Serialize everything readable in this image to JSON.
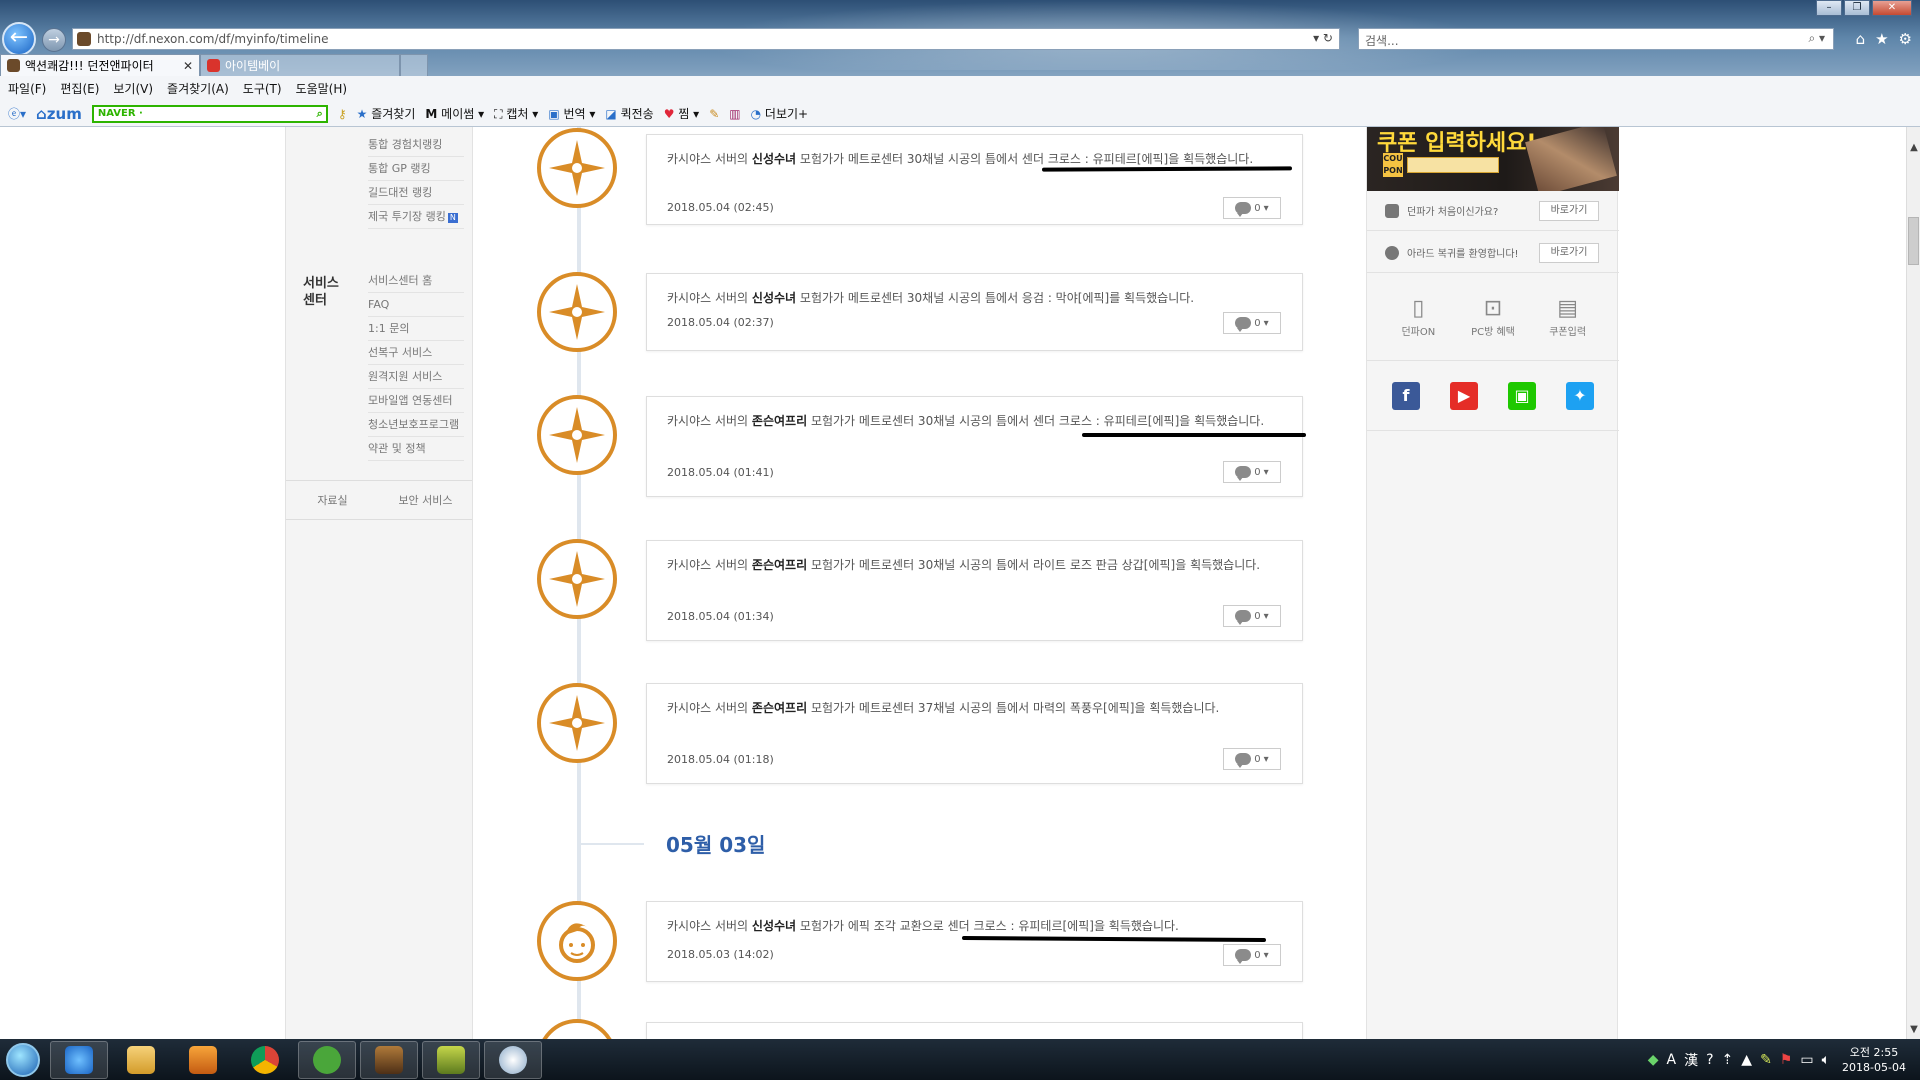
{
  "browser": {
    "window_controls": [
      "–",
      "❐",
      "✕"
    ],
    "url": "http://df.nexon.com/df/myinfo/timeline",
    "search_placeholder": "검색...",
    "tabs": [
      {
        "label": "액션쾌감!!! 던전앤파이터",
        "close": "✕",
        "active": true
      },
      {
        "label": "아이템베이",
        "close": "",
        "active": false
      }
    ],
    "menu": [
      "파일(F)",
      "편집(E)",
      "보기(V)",
      "즐겨찾기(A)",
      "도구(T)",
      "도움말(H)"
    ],
    "toolbar": {
      "zum": "zum",
      "naver_label": "NAVER ·",
      "items": [
        "즐겨찾기",
        "메이썸",
        "캡처",
        "번역",
        "퀵전송",
        "찜",
        "더보기+"
      ]
    }
  },
  "sidebar": {
    "ranking_items": [
      "통합 경험치랭킹",
      "통합 GP 랭킹",
      "길드대전 랭킹",
      "제국 투기장 랭킹"
    ],
    "new_badge": "N",
    "service_title": "서비스 센터",
    "service_items": [
      "서비스센터 홈",
      "FAQ",
      "1:1 문의",
      "선복구 서비스",
      "원격지원 서비스",
      "모바일앱 연동센터",
      "청소년보호프로그램",
      "약관 및 정책"
    ],
    "bottom_links": [
      "자료실",
      "보안 서비스"
    ]
  },
  "timeline": {
    "entries": [
      {
        "pre": "카시야스 서버의 ",
        "name": "신성수녀",
        "post": " 모험가가 메트로센터 30채널 시공의 틈에서 센더 크로스 : 유피테르[에픽]을 획득했습니다.",
        "date": "2018.05.04 (02:45)",
        "comments": "0"
      },
      {
        "pre": "카시야스 서버의 ",
        "name": "신성수녀",
        "post": " 모험가가 메트로센터 30채널 시공의 틈에서 응검 : 막야[에픽]를 획득했습니다.",
        "date": "2018.05.04 (02:37)",
        "comments": "0"
      },
      {
        "pre": "카시야스 서버의 ",
        "name": "존슨여프리",
        "post": " 모험가가 메트로센터 30채널 시공의 틈에서 센더 크로스 : 유피테르[에픽]을 획득했습니다.",
        "date": "2018.05.04 (01:41)",
        "comments": "0"
      },
      {
        "pre": "카시야스 서버의 ",
        "name": "존슨여프리",
        "post": " 모험가가 메트로센터 30채널 시공의 틈에서 라이트 로즈 판금 상갑[에픽]을 획득했습니다.",
        "date": "2018.05.04 (01:34)",
        "comments": "0"
      },
      {
        "pre": "카시야스 서버의 ",
        "name": "존슨여프리",
        "post": " 모험가가 메트로센터 37채널 시공의 틈에서 마력의 폭풍우[에픽]을 획득했습니다.",
        "date": "2018.05.04 (01:18)",
        "comments": "0"
      },
      {
        "pre": "카시야스 서버의 ",
        "name": "신성수녀",
        "post": " 모험가가 에픽 조각 교환으로 센더 크로스 : 유피테르[에픽]을 획득했습니다.",
        "date": "2018.05.03 (14:02)",
        "comments": "0"
      }
    ],
    "date_header": "05월 03일"
  },
  "right": {
    "banner_text": "쿠폰 입력하세요!",
    "banner_coupon": "COU PON",
    "rows": [
      {
        "label": "던파가 처음이신가요?",
        "button": "바로가기"
      },
      {
        "label": "아라드 복귀를 환영합니다!",
        "button": "바로가기"
      }
    ],
    "quick": [
      {
        "label": "던파ON",
        "icon": "▯"
      },
      {
        "label": "PC방 혜택",
        "icon": "⊡"
      },
      {
        "label": "쿠폰입력",
        "icon": "▤"
      }
    ],
    "social": [
      {
        "name": "facebook",
        "glyph": "f",
        "color": "#3b5998"
      },
      {
        "name": "youtube",
        "glyph": "▶",
        "color": "#e52d27"
      },
      {
        "name": "naver-tv",
        "glyph": "▣",
        "color": "#1ec800"
      },
      {
        "name": "twitter",
        "glyph": "✦",
        "color": "#1da1f2"
      }
    ]
  },
  "taskbar": {
    "tray_icons": [
      "A",
      "漢"
    ],
    "time": "오전 2:55",
    "date": "2018-05-04"
  }
}
